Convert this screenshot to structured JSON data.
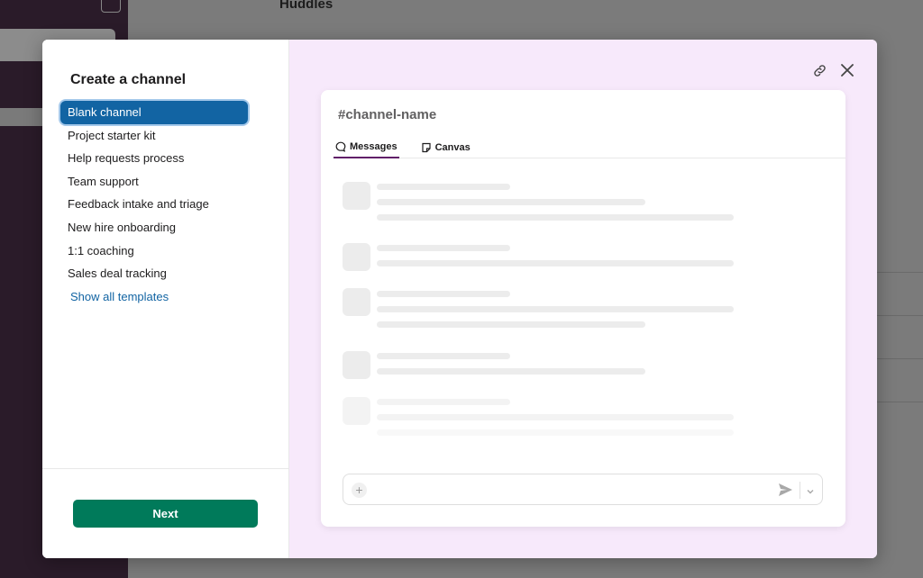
{
  "background": {
    "title": "Huddles"
  },
  "modal": {
    "title": "Create a channel",
    "templates": [
      {
        "label": "Blank channel",
        "selected": true
      },
      {
        "label": "Project starter kit",
        "selected": false
      },
      {
        "label": "Help requests process",
        "selected": false
      },
      {
        "label": "Team support",
        "selected": false
      },
      {
        "label": "Feedback intake and triage",
        "selected": false
      },
      {
        "label": "New hire onboarding",
        "selected": false
      },
      {
        "label": "1:1 coaching",
        "selected": false
      },
      {
        "label": "Sales deal tracking",
        "selected": false
      }
    ],
    "show_all_label": "Show all templates",
    "next_label": "Next"
  },
  "preview": {
    "channel_name": "#channel-name",
    "tabs": [
      {
        "label": "Messages",
        "icon": "chat-bubble-icon",
        "active": true
      },
      {
        "label": "Canvas",
        "icon": "canvas-icon",
        "active": false
      }
    ]
  },
  "colors": {
    "selected": "#1264a3",
    "link": "#1264a3",
    "primary_button": "#007a5a",
    "preview_bg": "#f7e9fb",
    "tab_underline": "#611f69"
  }
}
